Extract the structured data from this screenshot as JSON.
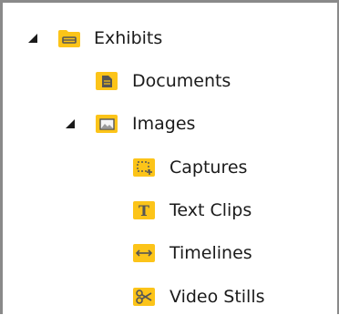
{
  "tree": {
    "root": {
      "label": "Exhibits",
      "icon": "folder-icon",
      "expanded": true,
      "children": [
        {
          "label": "Documents",
          "icon": "document-icon"
        },
        {
          "label": "Images",
          "icon": "image-icon",
          "expanded": true,
          "children": [
            {
              "label": "Captures",
              "icon": "selection-crop-icon"
            },
            {
              "label": "Text Clips",
              "icon": "text-icon"
            },
            {
              "label": "Timelines",
              "icon": "double-arrow-icon"
            },
            {
              "label": "Video Stills",
              "icon": "scissors-icon"
            }
          ]
        }
      ]
    }
  },
  "colors": {
    "icon_fill": "#FCC419",
    "icon_glyph": "#555555",
    "expander": "#1a1a1a",
    "frame_border": "#8a8a8a",
    "text": "#1b1b1b"
  }
}
